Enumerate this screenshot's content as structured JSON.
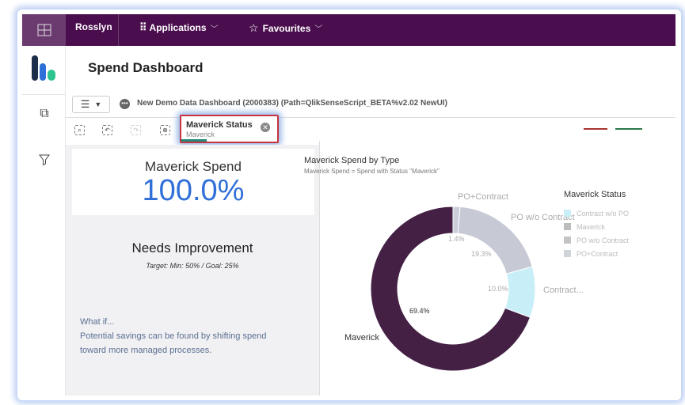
{
  "topbar": {
    "brand": "Rosslyn",
    "applications": "Applications",
    "favourites": "Favourites"
  },
  "page": {
    "title": "Spend Dashboard",
    "app_path": "New Demo Data Dashboard (2000383) (Path=QlikSenseScript_BETA%v2.02 NewUI)"
  },
  "selection": {
    "field": "Maverick Status",
    "value": "Maverick"
  },
  "kpi": {
    "label": "Maverick Spend",
    "value": "100.0%",
    "status": "Needs Improvement",
    "target": "Target: Min: 50% / Goal: 25%"
  },
  "whatif": {
    "line1": "What if...",
    "line2": "Potential savings can be found by shifting spend",
    "line3": "toward more managed processes."
  },
  "chart_data": {
    "type": "pie",
    "title": "Maverick Spend by Type",
    "subtitle": "Maverick Spend = Spend with Status \"Maverick\"",
    "legend_title": "Maverick Status",
    "legend_position": "right",
    "slices": [
      {
        "name": "PO+Contract",
        "label": "PO+Contract",
        "value": 1.4,
        "value_label": "1.4%",
        "color": "#c9ced8"
      },
      {
        "name": "PO w/o Contract",
        "label": "PO w/o Contract",
        "value": 19.3,
        "value_label": "19.3%",
        "color": "#c7c9d4"
      },
      {
        "name": "Contract w/o PO",
        "label": "Contract...",
        "value": 10.0,
        "value_label": "10.0%",
        "color": "#c8eef8"
      },
      {
        "name": "Maverick",
        "label": "Maverick",
        "value": 69.4,
        "value_label": "69.4%",
        "color": "#452045"
      }
    ],
    "legend": [
      {
        "name": "Contract w/o PO",
        "color": "#c8eef8"
      },
      {
        "name": "Maverick",
        "color": "#bdbdbd"
      },
      {
        "name": "PO w/o Contract",
        "color": "#c4c4c4"
      },
      {
        "name": "PO+Contract",
        "color": "#cfd3da"
      }
    ]
  }
}
